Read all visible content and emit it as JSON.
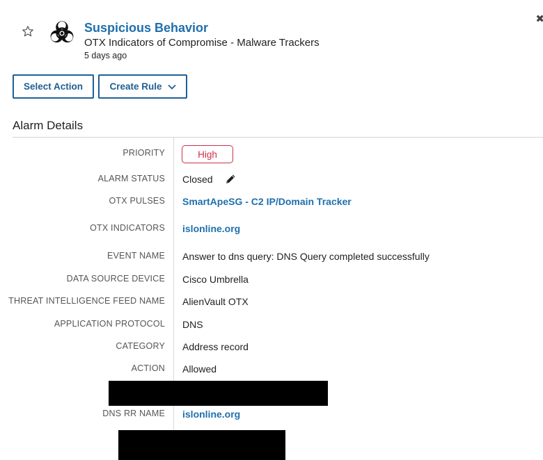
{
  "header": {
    "title": "Suspicious Behavior",
    "subtitle": "OTX Indicators of Compromise - Malware Trackers",
    "timestamp": "5 days ago",
    "close_glyph": "✖"
  },
  "actions": {
    "select_action_label": "Select Action",
    "create_rule_label": "Create Rule"
  },
  "section": {
    "title": "Alarm Details"
  },
  "details": {
    "priority": {
      "label": "PRIORITY",
      "value": "High"
    },
    "alarm_status": {
      "label": "ALARM STATUS",
      "value": "Closed"
    },
    "otx_pulses": {
      "label": "OTX PULSES",
      "value": "SmartApeSG - C2 IP/Domain Tracker"
    },
    "otx_indicators": {
      "label": "OTX INDICATORS",
      "value": "islonline.org"
    },
    "event_name": {
      "label": "EVENT NAME",
      "value": "Answer to dns query: DNS Query completed successfully"
    },
    "data_source_device": {
      "label": "DATA SOURCE DEVICE",
      "value": "Cisco Umbrella"
    },
    "threat_feed_name": {
      "label": "THREAT INTELLIGENCE FEED NAME",
      "value": "AlienVault OTX"
    },
    "app_protocol": {
      "label": "APPLICATION PROTOCOL",
      "value": "DNS"
    },
    "category": {
      "label": "CATEGORY",
      "value": "Address record"
    },
    "action": {
      "label": "ACTION",
      "value": "Allowed"
    },
    "dns_rr_name": {
      "label": "DNS RR NAME",
      "value": "islonline.org"
    }
  },
  "colors": {
    "link": "#1e6fad",
    "button_border": "#1e5f94",
    "priority_high": "#c9304a"
  },
  "icons": {
    "favorite": "star-outline-icon",
    "logo": "biohazard-icon",
    "edit": "pencil-icon",
    "dropdown": "chevron-down-icon",
    "close": "close-icon"
  }
}
